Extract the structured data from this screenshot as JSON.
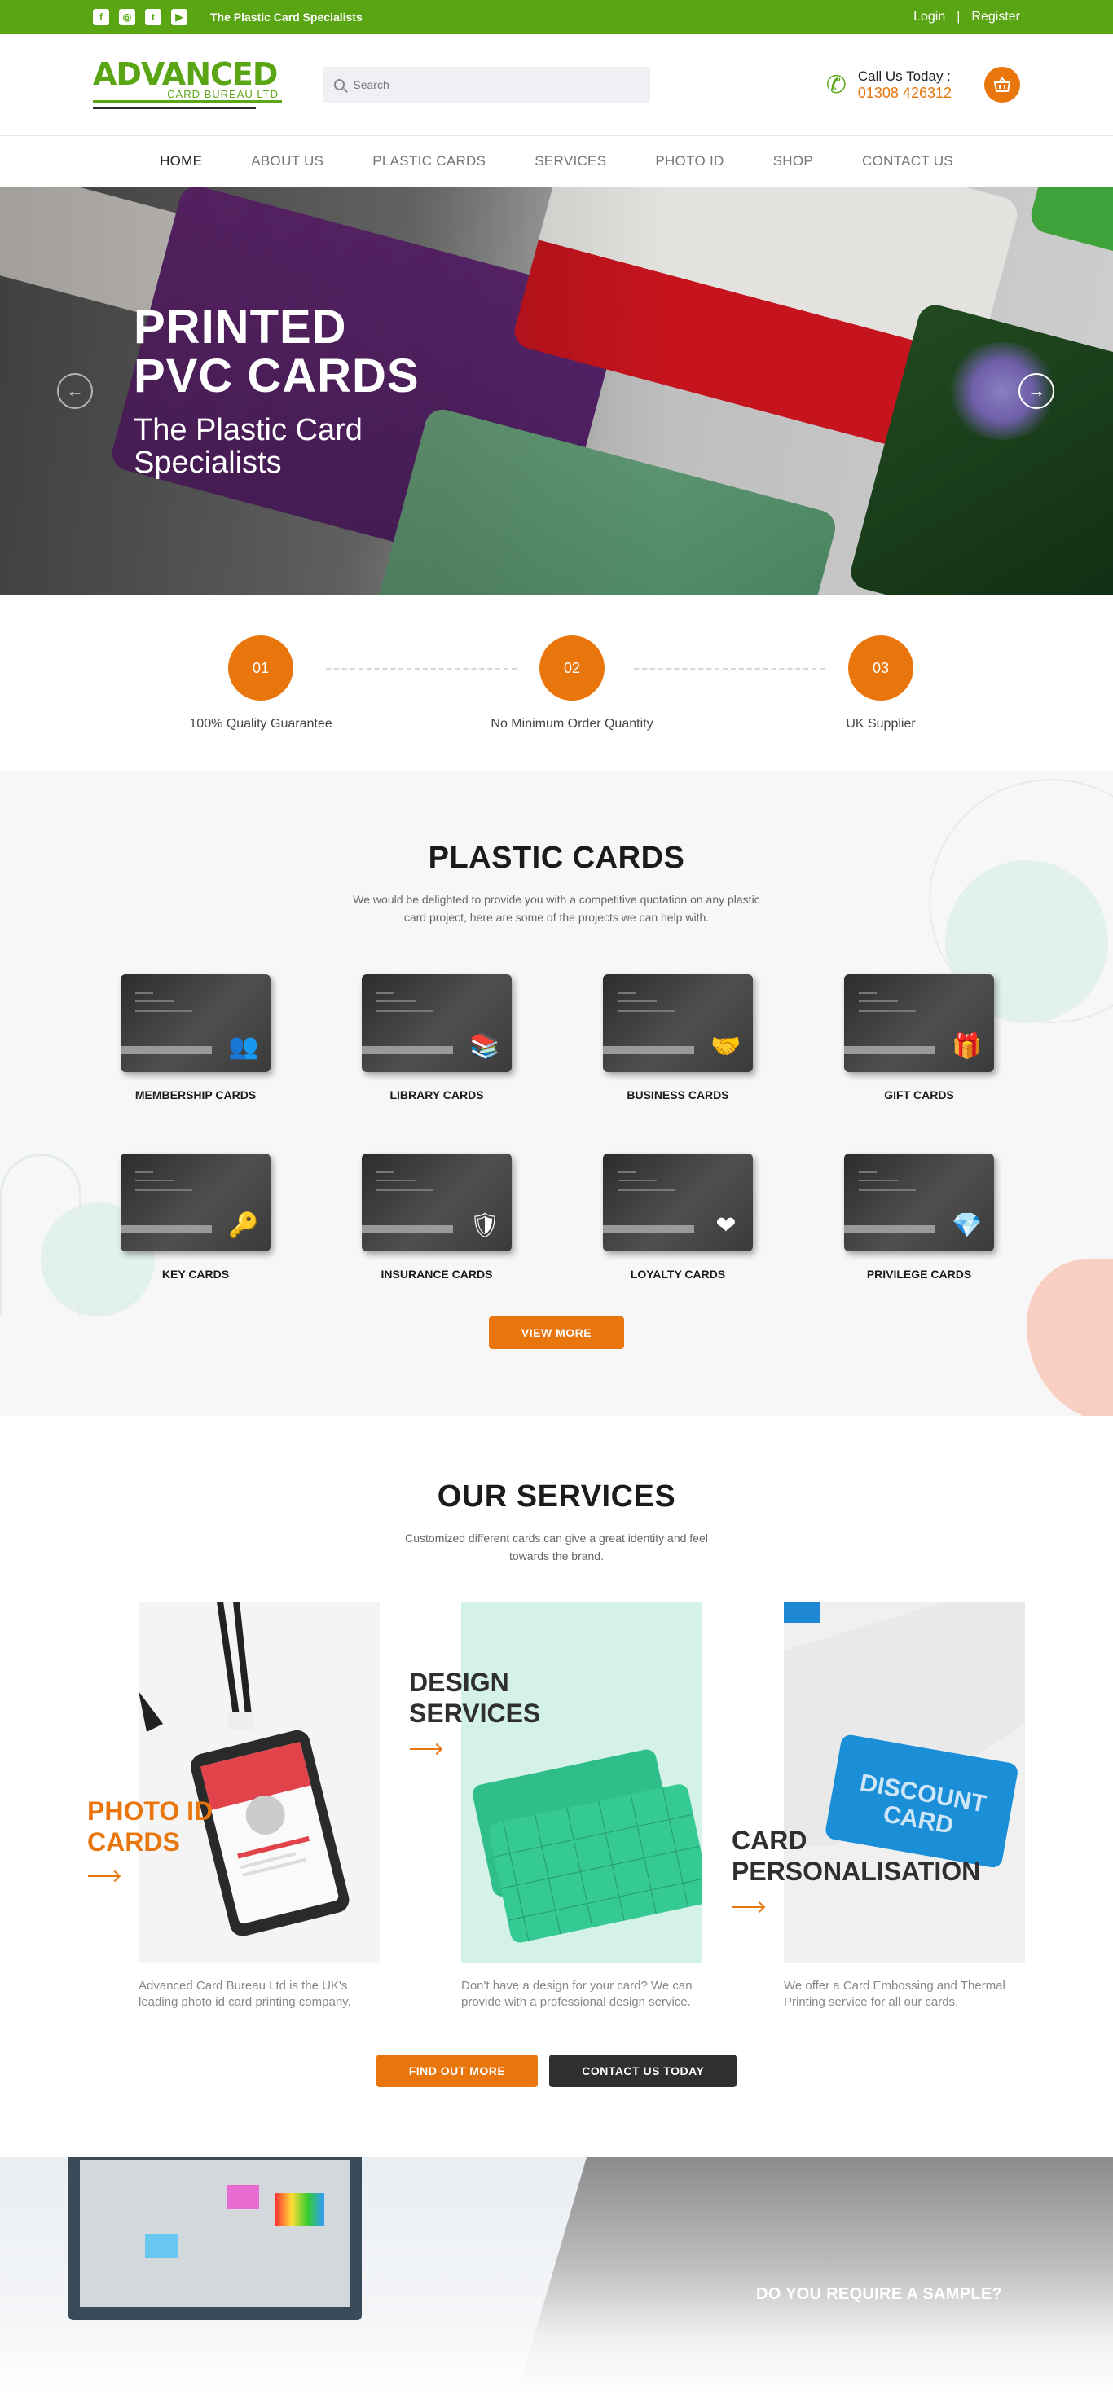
{
  "topbar": {
    "tagline": "The Plastic Card Specialists",
    "login": "Login",
    "separator": "|",
    "register": "Register",
    "social": [
      "f",
      "◎",
      "t",
      "▶"
    ]
  },
  "header": {
    "logo_main": "ADVANCED",
    "logo_sub": "CARD BUREAU LTD",
    "search_placeholder": "Search",
    "call_label": "Call Us Today :",
    "call_number": "01308 426312"
  },
  "nav": {
    "items": [
      "HOME",
      "ABOUT US",
      "PLASTIC CARDS",
      "SERVICES",
      "PHOTO ID",
      "SHOP",
      "CONTACT US"
    ],
    "active": "HOME"
  },
  "hero": {
    "title_line1": "PRINTED",
    "title_line2": "PVC CARDS",
    "subtitle": "The Plastic Card Specialists"
  },
  "steps": [
    {
      "num": "01",
      "label": "100% Quality Guarantee"
    },
    {
      "num": "02",
      "label": "No Minimum Order Quantity"
    },
    {
      "num": "03",
      "label": "UK Supplier"
    }
  ],
  "plastic_cards": {
    "title": "PLASTIC CARDS",
    "description": "We would be delighted to provide you with a competitive quotation on any plastic card project, here are some of the projects we can help with.",
    "cards": [
      {
        "label": "MEMBERSHIP CARDS",
        "icon": "users-icon"
      },
      {
        "label": "LIBRARY CARDS",
        "icon": "books-icon"
      },
      {
        "label": "BUSINESS CARDS",
        "icon": "handshake-icon"
      },
      {
        "label": "GIFT CARDS",
        "icon": "gift-icon"
      },
      {
        "label": "KEY CARDS",
        "icon": "key-icon"
      },
      {
        "label": "INSURANCE CARDS",
        "icon": "shield-icon"
      },
      {
        "label": "LOYALTY CARDS",
        "icon": "heart-hand-icon"
      },
      {
        "label": "PRIVILEGE CARDS",
        "icon": "diamond-icon"
      }
    ],
    "button": "VIEW MORE"
  },
  "services": {
    "title": "OUR SERVICES",
    "description": "Customized different cards can  give a great identity and feel towards the brand.",
    "items": [
      {
        "title": "PHOTO ID CARDS",
        "desc": "Advanced Card Bureau Ltd is the UK's leading photo id card printing company."
      },
      {
        "title": "DESIGN SERVICES",
        "desc": "Don't have a design for your card? We can provide with a professional design service."
      },
      {
        "title": "CARD PERSONALISATION",
        "desc": "We offer a Card Embossing and Thermal Printing service for all our cards."
      }
    ],
    "btn_find": "FIND OUT MORE",
    "btn_contact": "CONTACT US TODAY"
  },
  "sample": {
    "title": "DO YOU REQUIRE A SAMPLE?"
  },
  "colors": {
    "green": "#5aa514",
    "orange": "#e8760d",
    "dark": "#2f2f2f"
  }
}
